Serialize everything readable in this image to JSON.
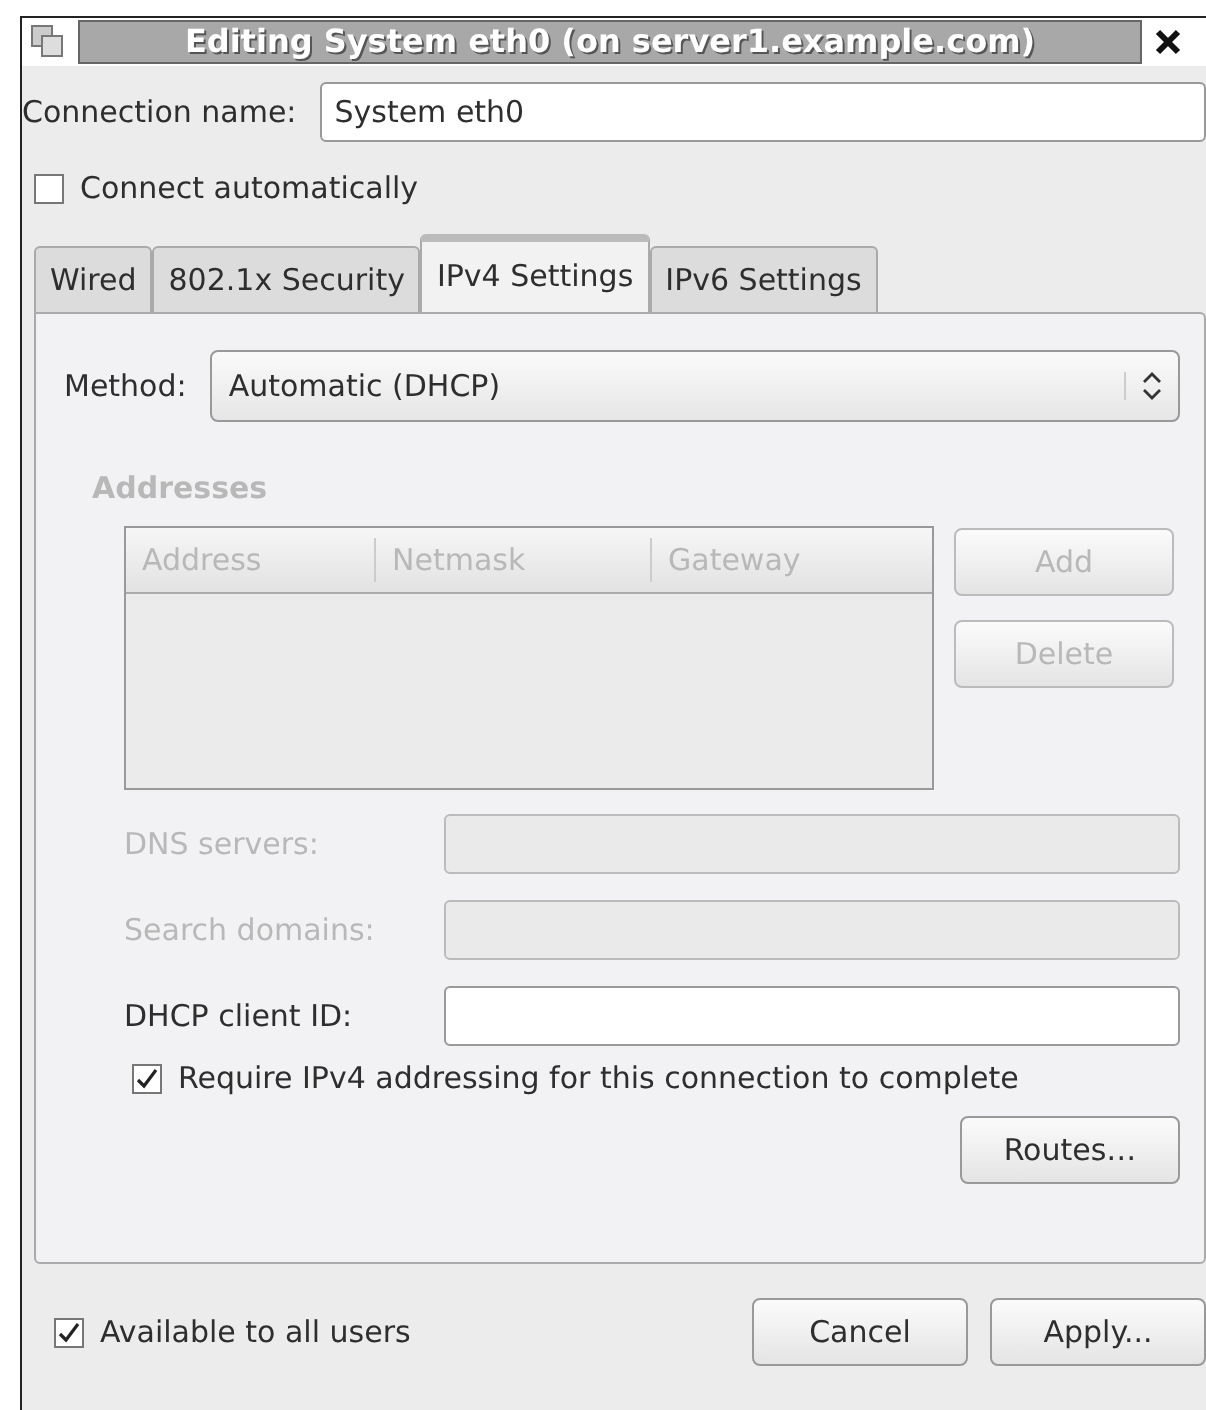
{
  "window": {
    "title": "Editing System eth0 (on server1.example.com)"
  },
  "connection_name": {
    "label": "Connection name:",
    "value": "System eth0"
  },
  "connect_automatically": {
    "label": "Connect automatically",
    "checked": false
  },
  "tabs": [
    {
      "label": "Wired",
      "selected": false
    },
    {
      "label": "802.1x Security",
      "selected": false
    },
    {
      "label": "IPv4 Settings",
      "selected": true
    },
    {
      "label": "IPv6 Settings",
      "selected": false
    }
  ],
  "method": {
    "label": "Method:",
    "value": "Automatic (DHCP)"
  },
  "addresses": {
    "label": "Addresses",
    "disabled": true,
    "columns": [
      "Address",
      "Netmask",
      "Gateway"
    ],
    "buttons": [
      {
        "label": "Add",
        "disabled": true
      },
      {
        "label": "Delete",
        "disabled": true
      }
    ]
  },
  "fields": [
    {
      "label": "DNS servers:",
      "disabled": true
    },
    {
      "label": "Search domains:",
      "disabled": true
    },
    {
      "label": "DHCP client ID:",
      "disabled": false
    }
  ],
  "require_ipv4": {
    "label": "Require IPv4 addressing for this connection to complete",
    "checked": true
  },
  "routes_button": "Routes…",
  "available_to_all": {
    "label": "Available to all users",
    "checked": true
  },
  "buttons": [
    "Cancel",
    "Apply..."
  ]
}
